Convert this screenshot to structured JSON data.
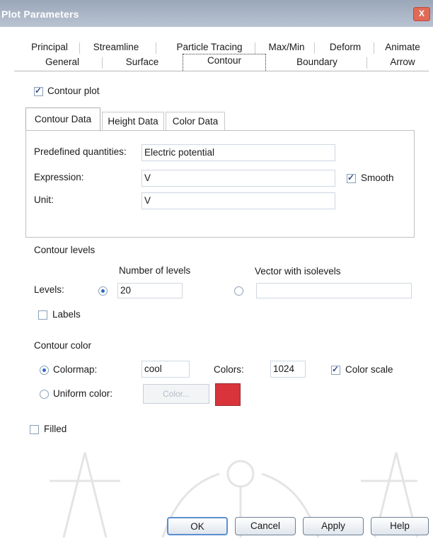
{
  "window": {
    "title": "Plot Parameters",
    "close_label": "X"
  },
  "tabs_row1": [
    "Principal",
    "Streamline",
    "Particle Tracing",
    "Max/Min",
    "Deform",
    "Animate"
  ],
  "tabs_row2": [
    "General",
    "Surface",
    "Contour",
    "Boundary",
    "Arrow"
  ],
  "active_tab": "Contour",
  "contour_plot": {
    "label": "Contour plot",
    "checked": true
  },
  "subtabs": [
    "Contour Data",
    "Height Data",
    "Color Data"
  ],
  "active_subtab": "Contour Data",
  "data_panel": {
    "predefined_label": "Predefined quantities:",
    "predefined_value": "Electric potential",
    "expression_label": "Expression:",
    "expression_value": "V",
    "smooth_label": "Smooth",
    "smooth_checked": true,
    "unit_label": "Unit:",
    "unit_value": "V"
  },
  "levels": {
    "section_title": "Contour levels",
    "number_header": "Number of levels",
    "vector_header": "Vector with isolevels",
    "levels_label": "Levels:",
    "number_value": "20",
    "vector_value": "",
    "labels_label": "Labels",
    "labels_checked": false
  },
  "color": {
    "section_title": "Contour color",
    "colormap_label": "Colormap:",
    "colormap_value": "cool",
    "colors_label": "Colors:",
    "colors_value": "1024",
    "color_scale_label": "Color scale",
    "color_scale_checked": true,
    "uniform_label": "Uniform color:",
    "color_button_label": "Color...",
    "swatch_color": "#d9343b"
  },
  "filled": {
    "label": "Filled",
    "checked": false
  },
  "buttons": {
    "ok": "OK",
    "cancel": "Cancel",
    "apply": "Apply",
    "help": "Help"
  },
  "accent_color": "#2d6cc2"
}
